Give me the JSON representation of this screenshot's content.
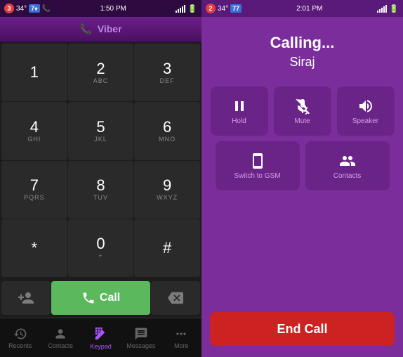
{
  "left": {
    "status_bar": {
      "notification_count": "3",
      "temp": "34°",
      "shield_count": "7♦",
      "time": "1:50 PM",
      "signal": "full"
    },
    "header": {
      "app_name": "Viber"
    },
    "keypad": {
      "keys": [
        {
          "number": "1",
          "letters": ""
        },
        {
          "number": "2",
          "letters": "ABC"
        },
        {
          "number": "3",
          "letters": "DEF"
        },
        {
          "number": "4",
          "letters": "GHI"
        },
        {
          "number": "5",
          "letters": "JKL"
        },
        {
          "number": "6",
          "letters": "MNO"
        },
        {
          "number": "7",
          "letters": "PQRS"
        },
        {
          "number": "8",
          "letters": "TUV"
        },
        {
          "number": "9",
          "letters": "WXYZ"
        },
        {
          "number": "*",
          "letters": ""
        },
        {
          "number": "0",
          "letters": "+"
        },
        {
          "number": "#",
          "letters": ""
        }
      ]
    },
    "action_row": {
      "add_contact_icon": "+👤",
      "call_label": "Call",
      "delete_icon": "⌫"
    },
    "bottom_nav": {
      "items": [
        {
          "id": "recents",
          "icon": "🕐",
          "label": "Recents"
        },
        {
          "id": "contacts",
          "icon": "👤",
          "label": "Contacts"
        },
        {
          "id": "keypad",
          "icon": "⌨",
          "label": "Keypad"
        },
        {
          "id": "messages",
          "icon": "💬",
          "label": "Messages"
        },
        {
          "id": "more",
          "icon": "•••",
          "label": "More"
        }
      ]
    }
  },
  "right": {
    "status_bar": {
      "notification_count": "2",
      "temp": "34°",
      "battery_pct": "77",
      "time": "2:01 PM"
    },
    "calling_section": {
      "title": "Calling...",
      "name": "Siraj"
    },
    "controls": {
      "row1": [
        {
          "id": "hold",
          "icon": "⏸",
          "label": "Hold"
        },
        {
          "id": "mute",
          "icon": "🎤",
          "label": "Mute"
        },
        {
          "id": "speaker",
          "icon": "🔊",
          "label": "Speaker"
        }
      ],
      "row2": [
        {
          "id": "switch-gsm",
          "icon": "📱",
          "label": "Switch to GSM"
        },
        {
          "id": "contacts",
          "icon": "👥",
          "label": "Contacts"
        }
      ]
    },
    "end_call": {
      "label": "End Call"
    }
  }
}
